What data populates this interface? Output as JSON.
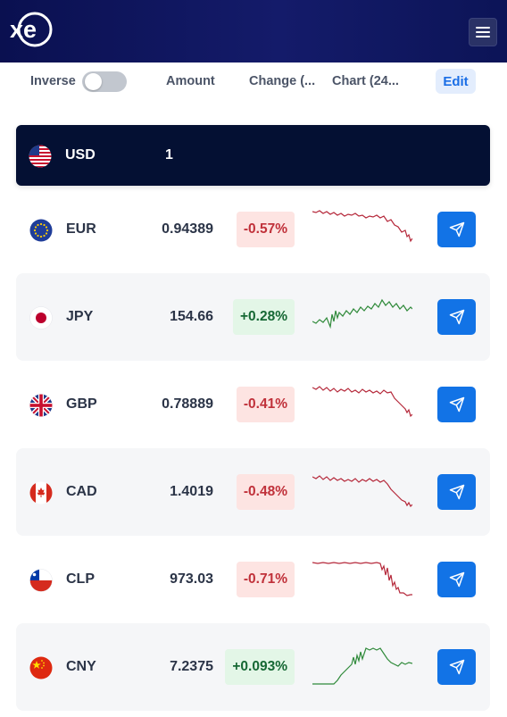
{
  "brand": {
    "logo_text": "xe"
  },
  "header": {
    "inverse_label": "Inverse",
    "inverse_on": false,
    "amount_label": "Amount",
    "change_label": "Change (...",
    "chart_label": "Chart (24...",
    "edit_label": "Edit"
  },
  "base": {
    "code": "USD",
    "amount": "1",
    "flag": "us-flag-icon"
  },
  "rows": [
    {
      "code": "EUR",
      "amount": "0.94389",
      "change": "-0.57%",
      "direction": "down",
      "flag": "eu-flag-icon"
    },
    {
      "code": "JPY",
      "amount": "154.66",
      "change": "+0.28%",
      "direction": "up",
      "flag": "jp-flag-icon"
    },
    {
      "code": "GBP",
      "amount": "0.78889",
      "change": "-0.41%",
      "direction": "down",
      "flag": "gb-flag-icon"
    },
    {
      "code": "CAD",
      "amount": "1.4019",
      "change": "-0.48%",
      "direction": "down",
      "flag": "ca-flag-icon"
    },
    {
      "code": "CLP",
      "amount": "973.03",
      "change": "-0.71%",
      "direction": "down",
      "flag": "cl-flag-icon"
    },
    {
      "code": "CNY",
      "amount": "7.2375",
      "change": "+0.093%",
      "direction": "up",
      "flag": "cn-flag-icon"
    }
  ],
  "colors": {
    "brand_navy": "#0a1050",
    "base_row": "#041033",
    "accent_blue": "#1273e6",
    "negative": "#c0313a",
    "positive": "#166834"
  }
}
